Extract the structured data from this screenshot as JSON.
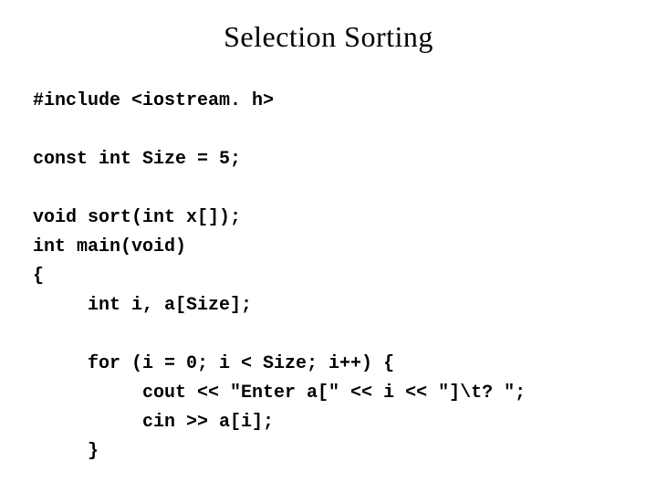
{
  "title": "Selection Sorting",
  "code": {
    "l1": "#include <iostream. h>",
    "l2": "",
    "l3": "const int Size = 5;",
    "l4": "",
    "l5": "void sort(int x[]);",
    "l6": "int main(void)",
    "l7": "{",
    "l8": "     int i, a[Size];",
    "l9": "",
    "l10": "     for (i = 0; i < Size; i++) {",
    "l11": "          cout << \"Enter a[\" << i << \"]\\t? \";",
    "l12": "          cin >> a[i];",
    "l13": "     }"
  }
}
